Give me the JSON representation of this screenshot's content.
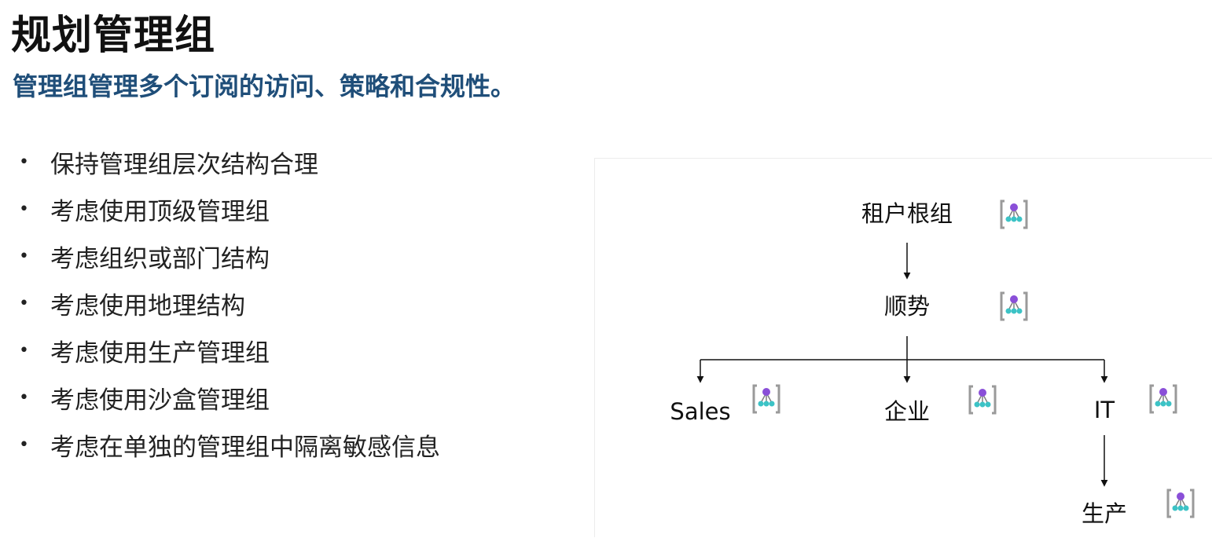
{
  "slide": {
    "title": "规划管理组",
    "subtitle": "管理组管理多个订阅的访问、策略和合规性。"
  },
  "bullets": {
    "marker": "•",
    "items": [
      "保持管理组层次结构合理",
      "考虑使用顶级管理组",
      "考虑组织或部门结构",
      "考虑使用地理结构",
      "考虑使用生产管理组",
      "考虑使用沙盒管理组",
      "考虑在单独的管理组中隔离敏感信息"
    ]
  },
  "diagram": {
    "icon": "management-group-icon",
    "colors": {
      "icon_bracket": "#9a9a9a",
      "icon_top_node": "#8a4fd8",
      "icon_child_nodes": "#3cc3c6",
      "connector": "#111111"
    },
    "nodes": {
      "root": "租户根组",
      "shunshi": "顺势",
      "sales": "Sales",
      "enterprise": "企业",
      "it": "IT",
      "production": "生产"
    }
  }
}
